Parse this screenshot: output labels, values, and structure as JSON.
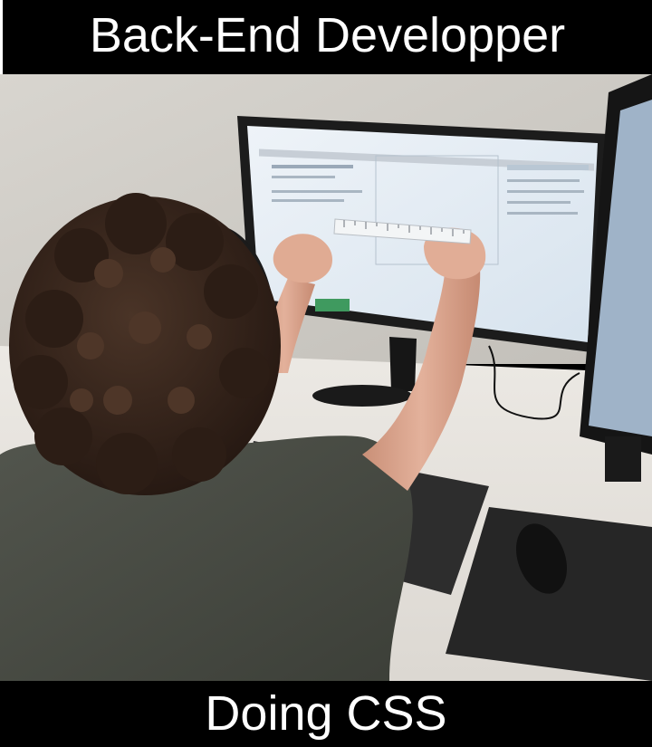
{
  "meme": {
    "top_caption": "Back-End Developper",
    "bottom_caption": "Doing CSS"
  },
  "colors": {
    "caption_bg": "#000000",
    "caption_text": "#ffffff",
    "wall": "#cfccc6",
    "desk": "#e6e3de",
    "shirt": "#4a4d45",
    "hair": "#3b2a20",
    "skin": "#d9a890",
    "monitor_bezel": "#1c1c1c",
    "screen": "#e4eef7"
  },
  "photo": {
    "icons": [
      "person-figure",
      "monitor",
      "second-monitor",
      "ruler",
      "keyboard",
      "mouse",
      "mousepad"
    ]
  }
}
